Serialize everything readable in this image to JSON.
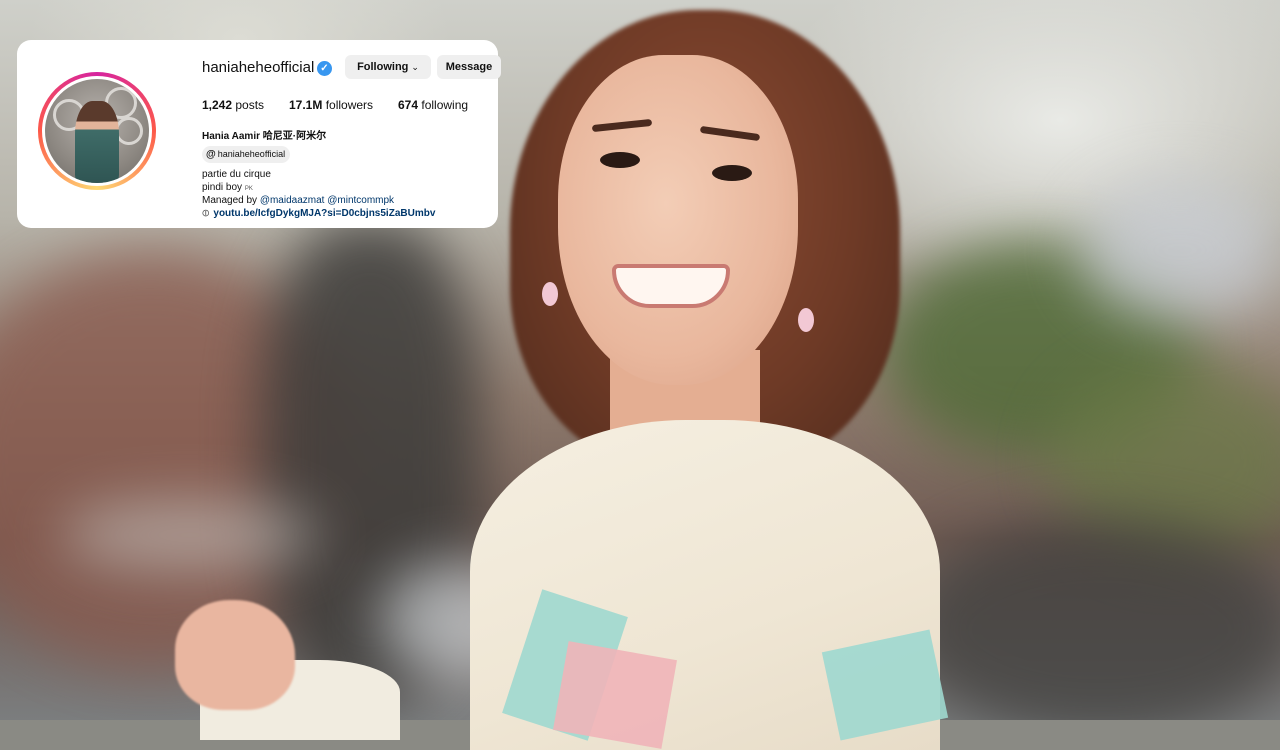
{
  "profile": {
    "username": "haniaheheofficial",
    "verified_icon": "verified-badge-icon",
    "buttons": {
      "following_label": "Following",
      "message_label": "Message"
    },
    "stats": {
      "posts_count": "1,242",
      "posts_label": "posts",
      "followers_count": "17.1M",
      "followers_label": "followers",
      "following_count": "674",
      "following_label": "following"
    },
    "full_name": "Hania Aamir 哈尼亚·阿米尔",
    "threads_handle": "haniaheheofficial",
    "bio": {
      "line1": "partie du cirque",
      "line2_text": "pindi boy",
      "line2_flag": "PK",
      "line3_prefix": "Managed by",
      "mention1": "@maidaazmat",
      "mention2": "@mintcommpk"
    },
    "link": "youtu.be/IcfgDykgMJA?si=D0cbjns5iZaBUmbv"
  },
  "colors": {
    "link_blue": "#00376b",
    "verified_blue": "#3897f0",
    "button_gray": "#efefef"
  }
}
